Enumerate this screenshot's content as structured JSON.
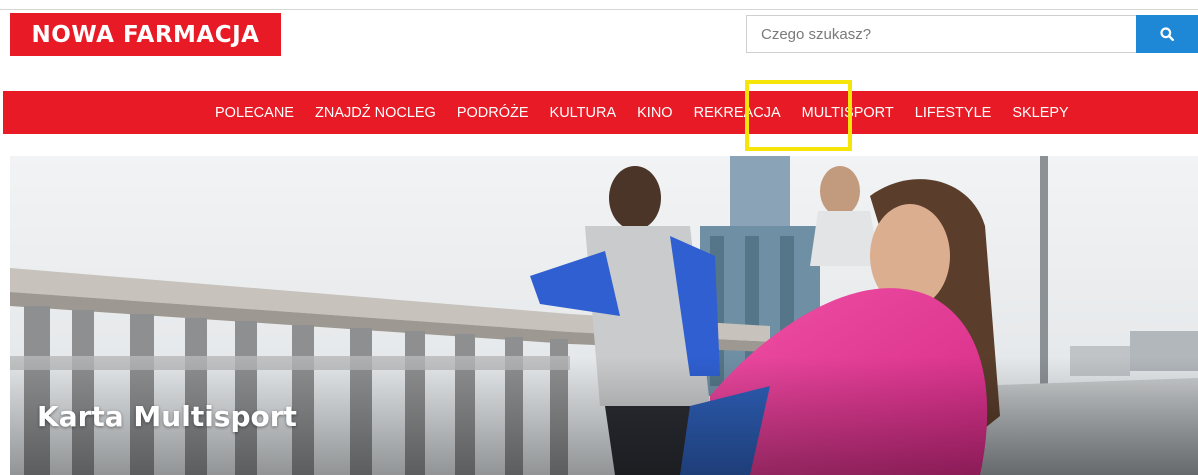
{
  "header": {
    "logo_text": "NOWA FARMACJA",
    "search": {
      "placeholder": "Czego szukasz?",
      "button_icon": "search-icon"
    }
  },
  "nav": {
    "items": [
      {
        "label": "POLECANE"
      },
      {
        "label": "ZNAJDŹ NOCLEG"
      },
      {
        "label": "PODRÓŻE"
      },
      {
        "label": "KULTURA"
      },
      {
        "label": "KINO"
      },
      {
        "label": "REKREACJA"
      },
      {
        "label": "MULTISPORT",
        "highlighted": true
      },
      {
        "label": "LIFESTYLE"
      },
      {
        "label": "SKLEPY"
      }
    ]
  },
  "hero": {
    "title": "Karta Multisport",
    "image": "runners-on-bridge-photo"
  },
  "colors": {
    "brand_red": "#e81a25",
    "search_blue": "#1e88d6",
    "highlight_yellow": "#f5e508"
  }
}
